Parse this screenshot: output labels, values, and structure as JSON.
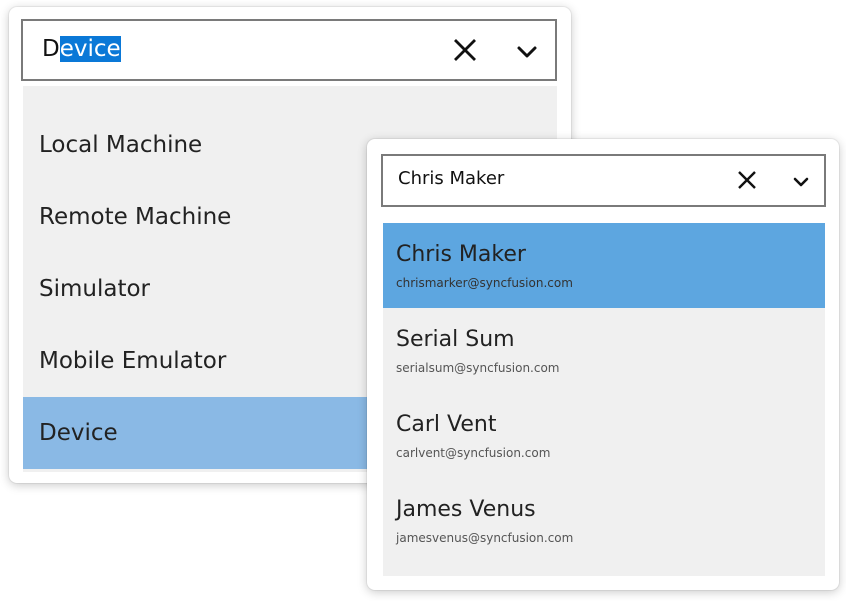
{
  "combobox_device": {
    "input_text_prefix": "D",
    "input_text_selected": "evice",
    "clear_icon": "close-x-icon",
    "dropdown_icon": "chevron-down-icon",
    "items": [
      {
        "label": "Local Machine",
        "selected": false
      },
      {
        "label": "Remote Machine",
        "selected": false
      },
      {
        "label": "Simulator",
        "selected": false
      },
      {
        "label": "Mobile Emulator",
        "selected": false
      },
      {
        "label": "Device",
        "selected": true
      }
    ]
  },
  "combobox_contacts": {
    "input_text": "Chris Maker",
    "clear_icon": "close-x-icon",
    "dropdown_icon": "chevron-down-icon",
    "items": [
      {
        "name": "Chris Maker",
        "email": "chrismarker@syncfusion.com",
        "selected": true
      },
      {
        "name": "Serial Sum",
        "email": "serialsum@syncfusion.com",
        "selected": false
      },
      {
        "name": "Carl Vent",
        "email": "carlvent@syncfusion.com",
        "selected": false
      },
      {
        "name": "James Venus",
        "email": "jamesvenus@syncfusion.com",
        "selected": false
      }
    ]
  },
  "colors": {
    "selection_highlight": "#0a78d7",
    "selected_item_device": "#8ab9e5",
    "selected_item_contact": "#5da6e0",
    "popup_background": "#f0f0f0",
    "input_border": "#7a7a7a"
  }
}
